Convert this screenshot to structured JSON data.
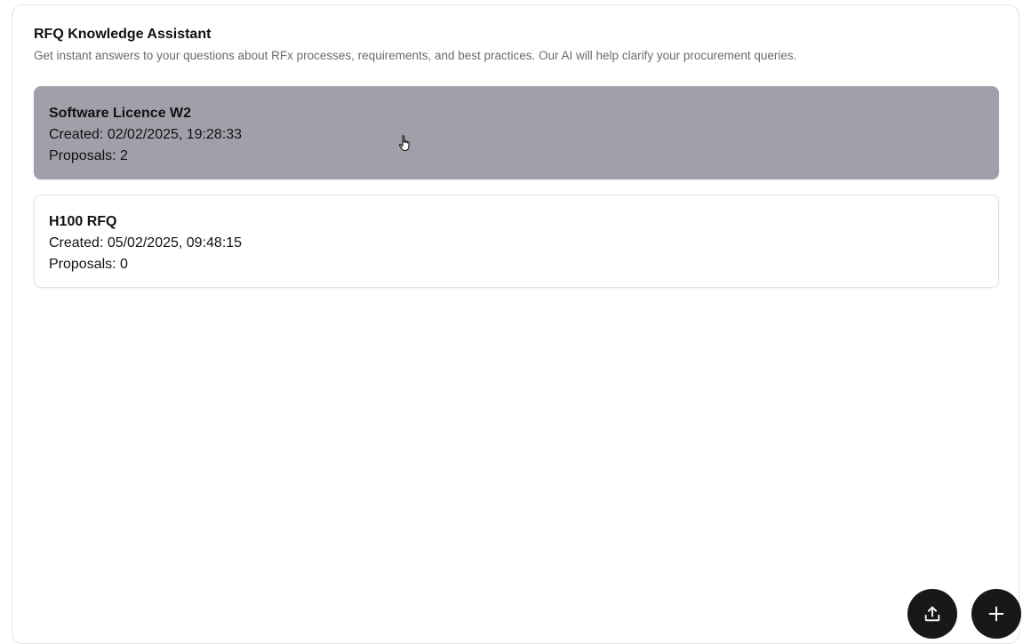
{
  "header": {
    "title": "RFQ Knowledge Assistant",
    "subtitle": "Get instant answers to your questions about RFx processes, requirements, and best practices. Our AI will help clarify your procurement queries."
  },
  "rfqs": [
    {
      "name": "Software Licence W2",
      "created": "Created: 02/02/2025, 19:28:33",
      "proposals": "Proposals: 2",
      "hovered": true
    },
    {
      "name": "H100 RFQ",
      "created": "Created: 05/02/2025, 09:48:15",
      "proposals": "Proposals: 0",
      "hovered": false
    }
  ],
  "actions": {
    "upload_icon": "upload-icon",
    "add_icon": "plus-icon"
  },
  "colors": {
    "hover_card": "#a0a0aa",
    "fab": "#18181b",
    "subtitle": "#6b6b70"
  }
}
